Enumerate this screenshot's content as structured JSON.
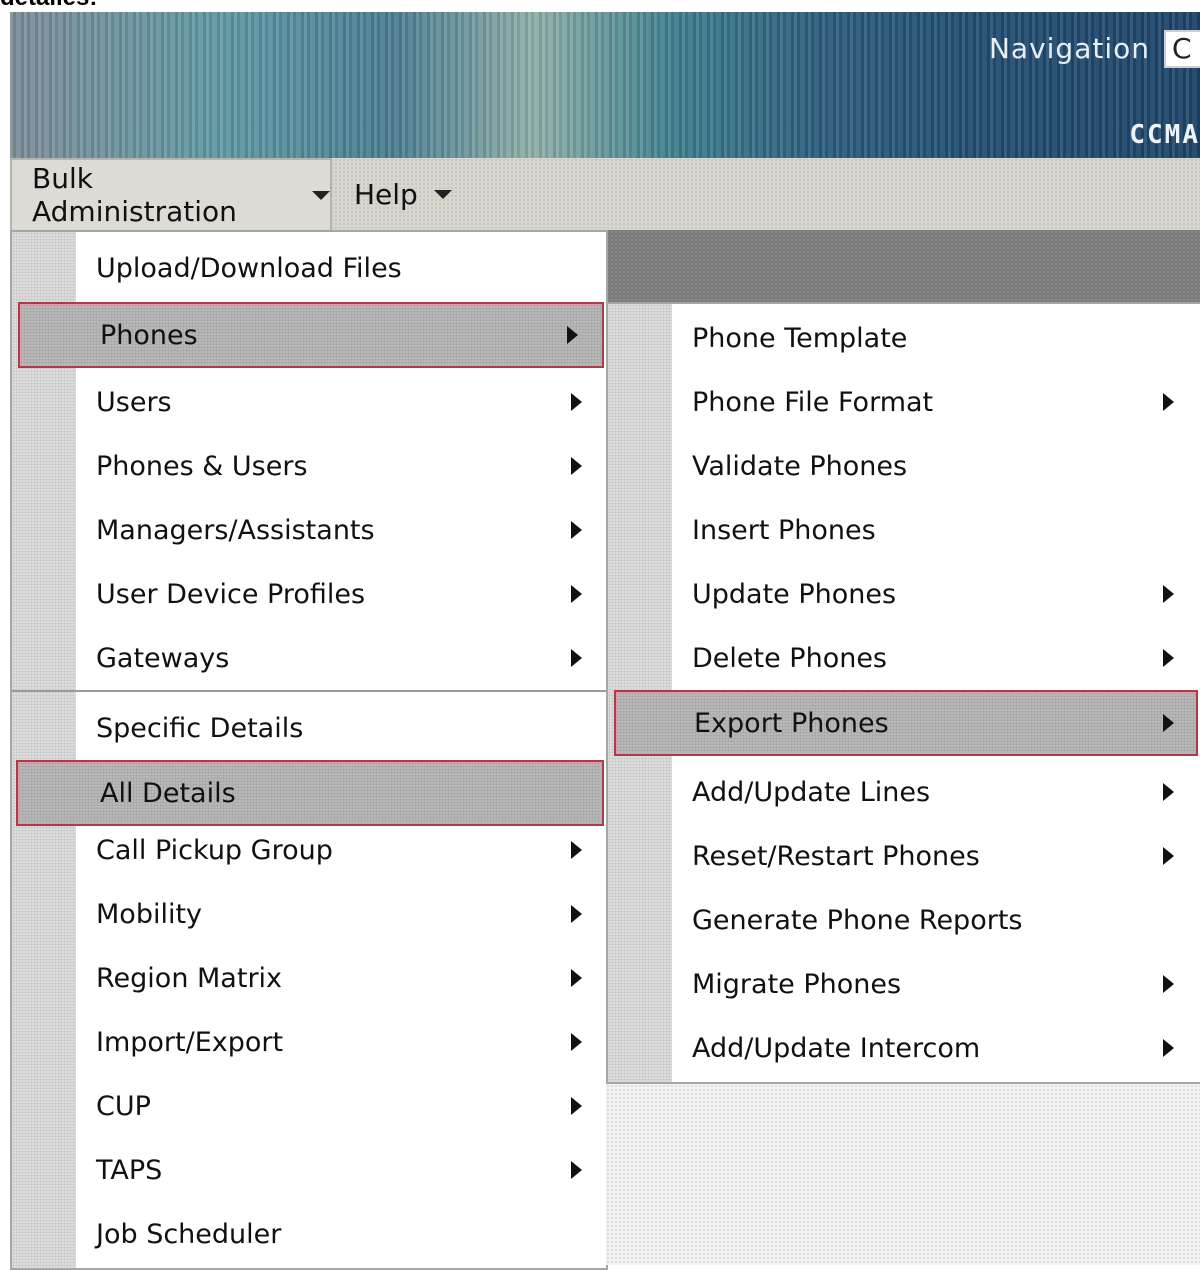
{
  "page": {
    "cut_text": "detalles:"
  },
  "header": {
    "navigation_label": "Navigation",
    "navigation_value": "C",
    "product_text": "CCMA"
  },
  "menubar": {
    "items": [
      {
        "label": "Bulk Administration"
      },
      {
        "label": "Help"
      }
    ]
  },
  "main_menu": {
    "items": [
      {
        "label": "Upload/Download Files",
        "submenu": false
      },
      {
        "label": "Phones",
        "submenu": true,
        "highlighted": true
      },
      {
        "label": "Users",
        "submenu": true
      },
      {
        "label": "Phones & Users",
        "submenu": true
      },
      {
        "label": "Managers/Assistants",
        "submenu": true
      },
      {
        "label": "User Device Profiles",
        "submenu": true
      },
      {
        "label": "Gateways",
        "submenu": true
      },
      {
        "label": "Specific Details",
        "submenu": false
      },
      {
        "label": "All Details",
        "submenu": false,
        "highlighted": true
      },
      {
        "label": "Call Pickup Group",
        "submenu": true
      },
      {
        "label": "Mobility",
        "submenu": true
      },
      {
        "label": "Region Matrix",
        "submenu": true
      },
      {
        "label": "Import/Export",
        "submenu": true
      },
      {
        "label": "CUP",
        "submenu": true
      },
      {
        "label": "TAPS",
        "submenu": true
      },
      {
        "label": "Job Scheduler",
        "submenu": false
      }
    ]
  },
  "phones_submenu": {
    "items": [
      {
        "label": "Phone Template",
        "submenu": false
      },
      {
        "label": "Phone File Format",
        "submenu": true
      },
      {
        "label": "Validate Phones",
        "submenu": false
      },
      {
        "label": "Insert Phones",
        "submenu": false
      },
      {
        "label": "Update Phones",
        "submenu": true
      },
      {
        "label": "Delete Phones",
        "submenu": true
      },
      {
        "label": "Export Phones",
        "submenu": true,
        "highlighted": true
      },
      {
        "label": "Add/Update Lines",
        "submenu": true
      },
      {
        "label": "Reset/Restart Phones",
        "submenu": true
      },
      {
        "label": "Generate Phone Reports",
        "submenu": false
      },
      {
        "label": "Migrate Phones",
        "submenu": true
      },
      {
        "label": "Add/Update Intercom",
        "submenu": true
      }
    ]
  },
  "colors": {
    "highlight_border": "#b03a48",
    "menubar_bg": "#d8d6cf",
    "banner_dark": "#1e456a"
  }
}
